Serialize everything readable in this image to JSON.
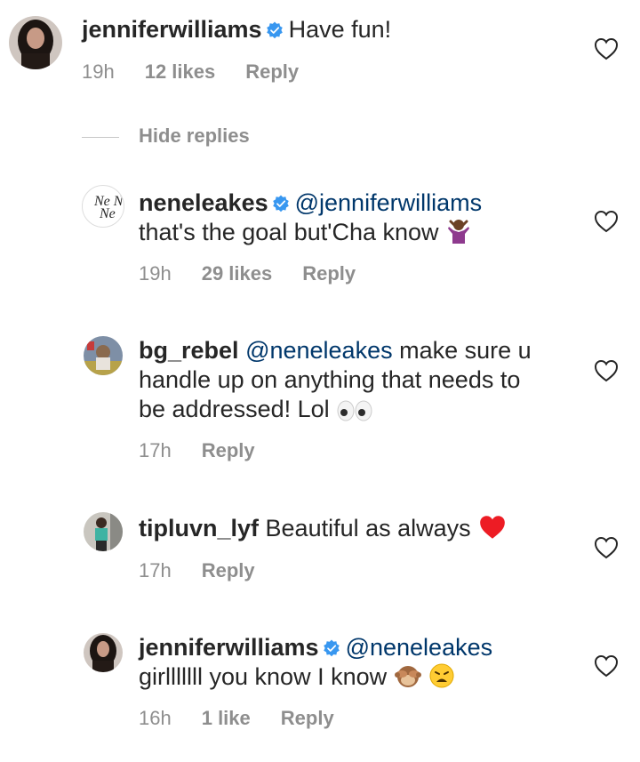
{
  "comments": [
    {
      "username": "jenniferwilliams",
      "text": "Have fun!",
      "time": "19h",
      "likes": "12 likes",
      "reply": "Reply"
    },
    {
      "username": "neneleakes",
      "mention": "@jenniferwilliams",
      "text": "that's the goal but'Cha know",
      "time": "19h",
      "likes": "29 likes",
      "reply": "Reply"
    },
    {
      "username": "bg_rebel",
      "mention": "@neneleakes",
      "text_line1": "make sure u",
      "text_line2": "handle up on anything that needs to",
      "text_line3": "be addressed! Lol",
      "time": "17h",
      "reply": "Reply"
    },
    {
      "username": "tipluvn_lyf",
      "text": "Beautiful as always",
      "time": "17h",
      "reply": "Reply"
    },
    {
      "username": "jenniferwilliams",
      "mention": "@neneleakes",
      "text": "girlllllll you know I know",
      "time": "16h",
      "likes": "1 like",
      "reply": "Reply"
    }
  ],
  "hide_replies": "Hide replies",
  "avatar_text": "Ne Ne",
  "icons": {
    "heart": "heart-outline-icon",
    "verified": "verified-badge-icon"
  },
  "colors": {
    "verified": "#3897f0",
    "mention": "#00376b",
    "meta": "#8e8e8e",
    "heart_emoji": "#ed1c24"
  }
}
